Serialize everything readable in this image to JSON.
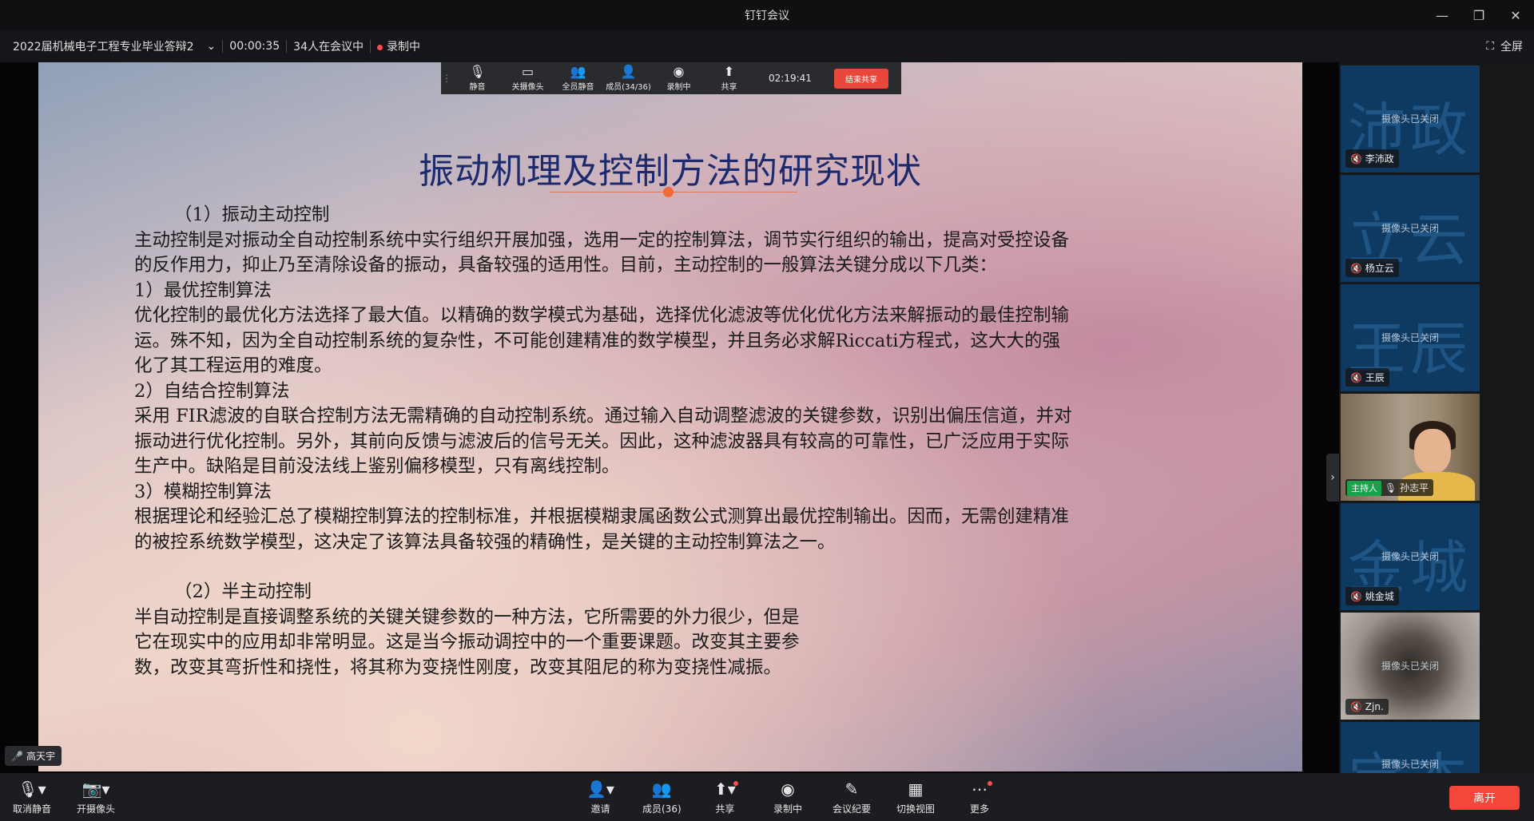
{
  "window": {
    "title": "钉钉会议"
  },
  "meeting": {
    "name": "2022届机械电子工程专业毕业答辩2",
    "duration": "00:00:35",
    "participants_text": "34人在会议中",
    "recording_text": "录制中",
    "fullscreen_label": "全屏"
  },
  "sharebar": {
    "buttons": [
      {
        "label": "静音",
        "icon": "mic-icon"
      },
      {
        "label": "关摄像头",
        "icon": "camera-icon"
      },
      {
        "label": "全员静音",
        "icon": "mute-all-icon"
      },
      {
        "label": "成员(34/36)",
        "icon": "members-icon"
      },
      {
        "label": "录制中",
        "icon": "record-icon"
      },
      {
        "label": "共享",
        "icon": "share-icon"
      }
    ],
    "time": "02:19:41",
    "stop_label": "结束共享"
  },
  "slide": {
    "title": "振动机理及控制方法的研究现状",
    "lines": [
      "（1）振动主动控制",
      "主动控制是对振动全自动控制系统中实行组织开展加强，选用一定的控制算法，调节实行组织的输出，提高对受控设备",
      "的反作用力，抑止乃至清除设备的振动，具备较强的适用性。目前，主动控制的一般算法关键分成以下几类：",
      "1）最优控制算法",
      "优化控制的最优化方法选择了最大值。以精确的数学模式为基础，选择优化滤波等优化优化方法来解振动的最佳控制输",
      "运。殊不知，因为全自动控制系统的复杂性，不可能创建精准的数学模型，并且务必求解Riccati方程式，这大大的强",
      "化了其工程运用的难度。",
      "2）自结合控制算法",
      "采用 FIR滤波的自联合控制方法无需精确的自动控制系统。通过输入自动调整滤波的关键参数，识别出偏压信道，并对",
      "振动进行优化控制。另外，其前向反馈与滤波后的信号无关。因此，这种滤波器具有较高的可靠性，已广泛应用于实际",
      "生产中。缺陷是目前没法线上鉴别偏移模型，只有离线控制。",
      "3）模糊控制算法",
      "根据理论和经验汇总了模糊控制算法的控制标准，并根据模糊隶属函数公式测算出最优控制输出。因而，无需创建精准",
      "的被控系统数学模型，这决定了该算法具备较强的精确性，是关键的主动控制算法之一。",
      "（2）半主动控制",
      "半自动控制是直接调整系统的关键关键参数的一种方法，它所需要的外力很少，但是",
      "它在现实中的应用却非常明显。这是当今振动调控中的一个重要课题。改变其主要参",
      "数，改变其弯折性和挠性，将其称为变挠性刚度，改变其阻尼的称为变挠性减振。"
    ]
  },
  "speaker": {
    "name": "高天宇"
  },
  "participants": [
    {
      "initials": "沛政",
      "status": "摄像头已关闭",
      "name": "李沛政"
    },
    {
      "initials": "立云",
      "status": "摄像头已关闭",
      "name": "杨立云"
    },
    {
      "initials": "王辰",
      "status": "摄像头已关闭",
      "name": "王辰"
    },
    {
      "host_label": "主持人",
      "name": "孙志平"
    },
    {
      "initials": "金城",
      "status": "摄像头已关闭",
      "name": "姚金城"
    },
    {
      "status": "摄像头已关闭",
      "name": "Zjn."
    },
    {
      "initials": "宝杰",
      "status": "摄像头已关闭"
    }
  ],
  "toolbar": {
    "unmute": "取消静音",
    "camera": "开摄像头",
    "invite": "邀请",
    "members": "成员(36)",
    "share": "共享",
    "recording": "录制中",
    "minutes": "会议纪要",
    "switch_view": "切换视图",
    "more": "更多",
    "leave": "离开"
  }
}
